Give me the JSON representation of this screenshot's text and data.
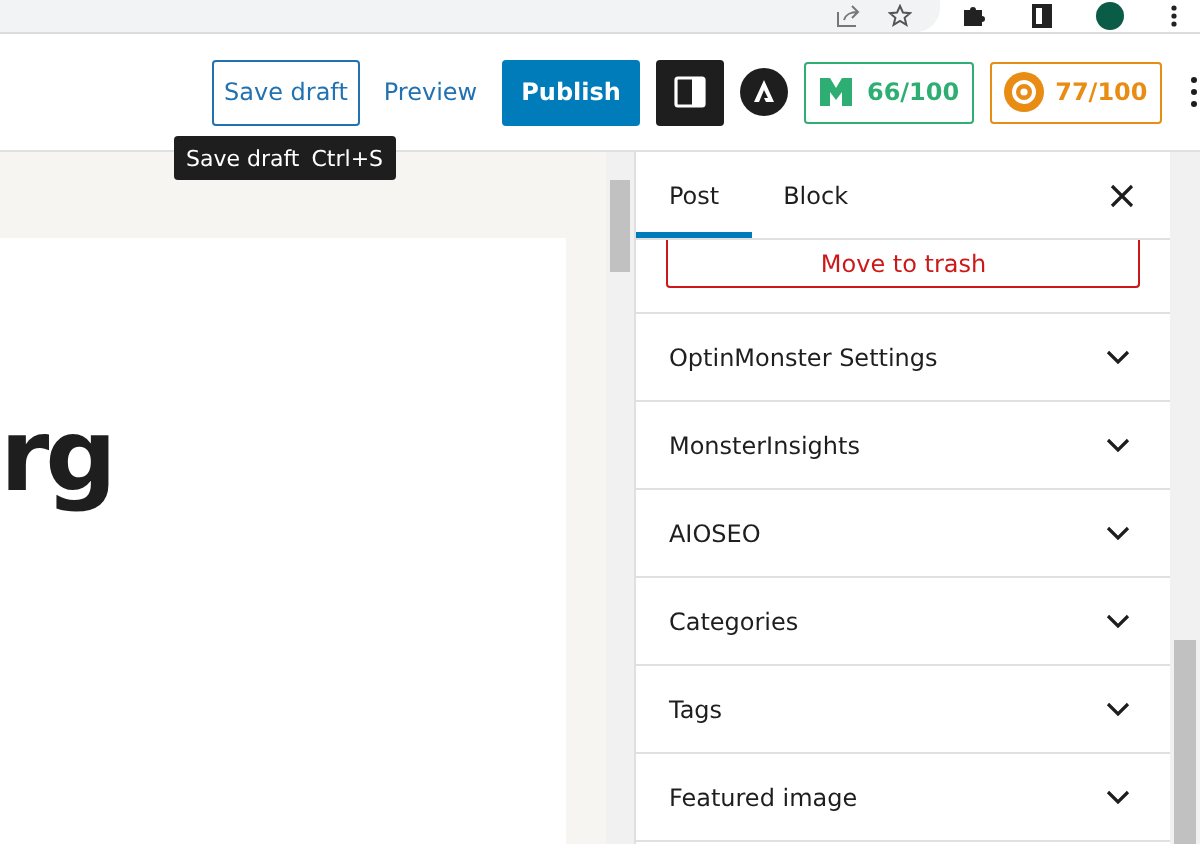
{
  "header": {
    "save_draft": "Save draft",
    "preview": "Preview",
    "publish": "Publish",
    "scores": [
      {
        "value": "66/100",
        "color": "#2eae72"
      },
      {
        "value": "77/100",
        "color": "#e88c13"
      }
    ]
  },
  "tooltip": {
    "label": "Save draft",
    "shortcut": "Ctrl+S"
  },
  "canvas": {
    "title_fragment": "rg"
  },
  "sidebar": {
    "tabs": [
      {
        "label": "Post",
        "selected": true
      },
      {
        "label": "Block",
        "selected": false
      }
    ],
    "trash_button": "Move to trash",
    "panels": [
      {
        "label": "OptinMonster Settings",
        "expanded": false
      },
      {
        "label": "MonsterInsights",
        "expanded": false
      },
      {
        "label": "AIOSEO",
        "expanded": false
      },
      {
        "label": "Categories",
        "expanded": false
      },
      {
        "label": "Tags",
        "expanded": false
      },
      {
        "label": "Featured image",
        "expanded": false
      }
    ]
  }
}
